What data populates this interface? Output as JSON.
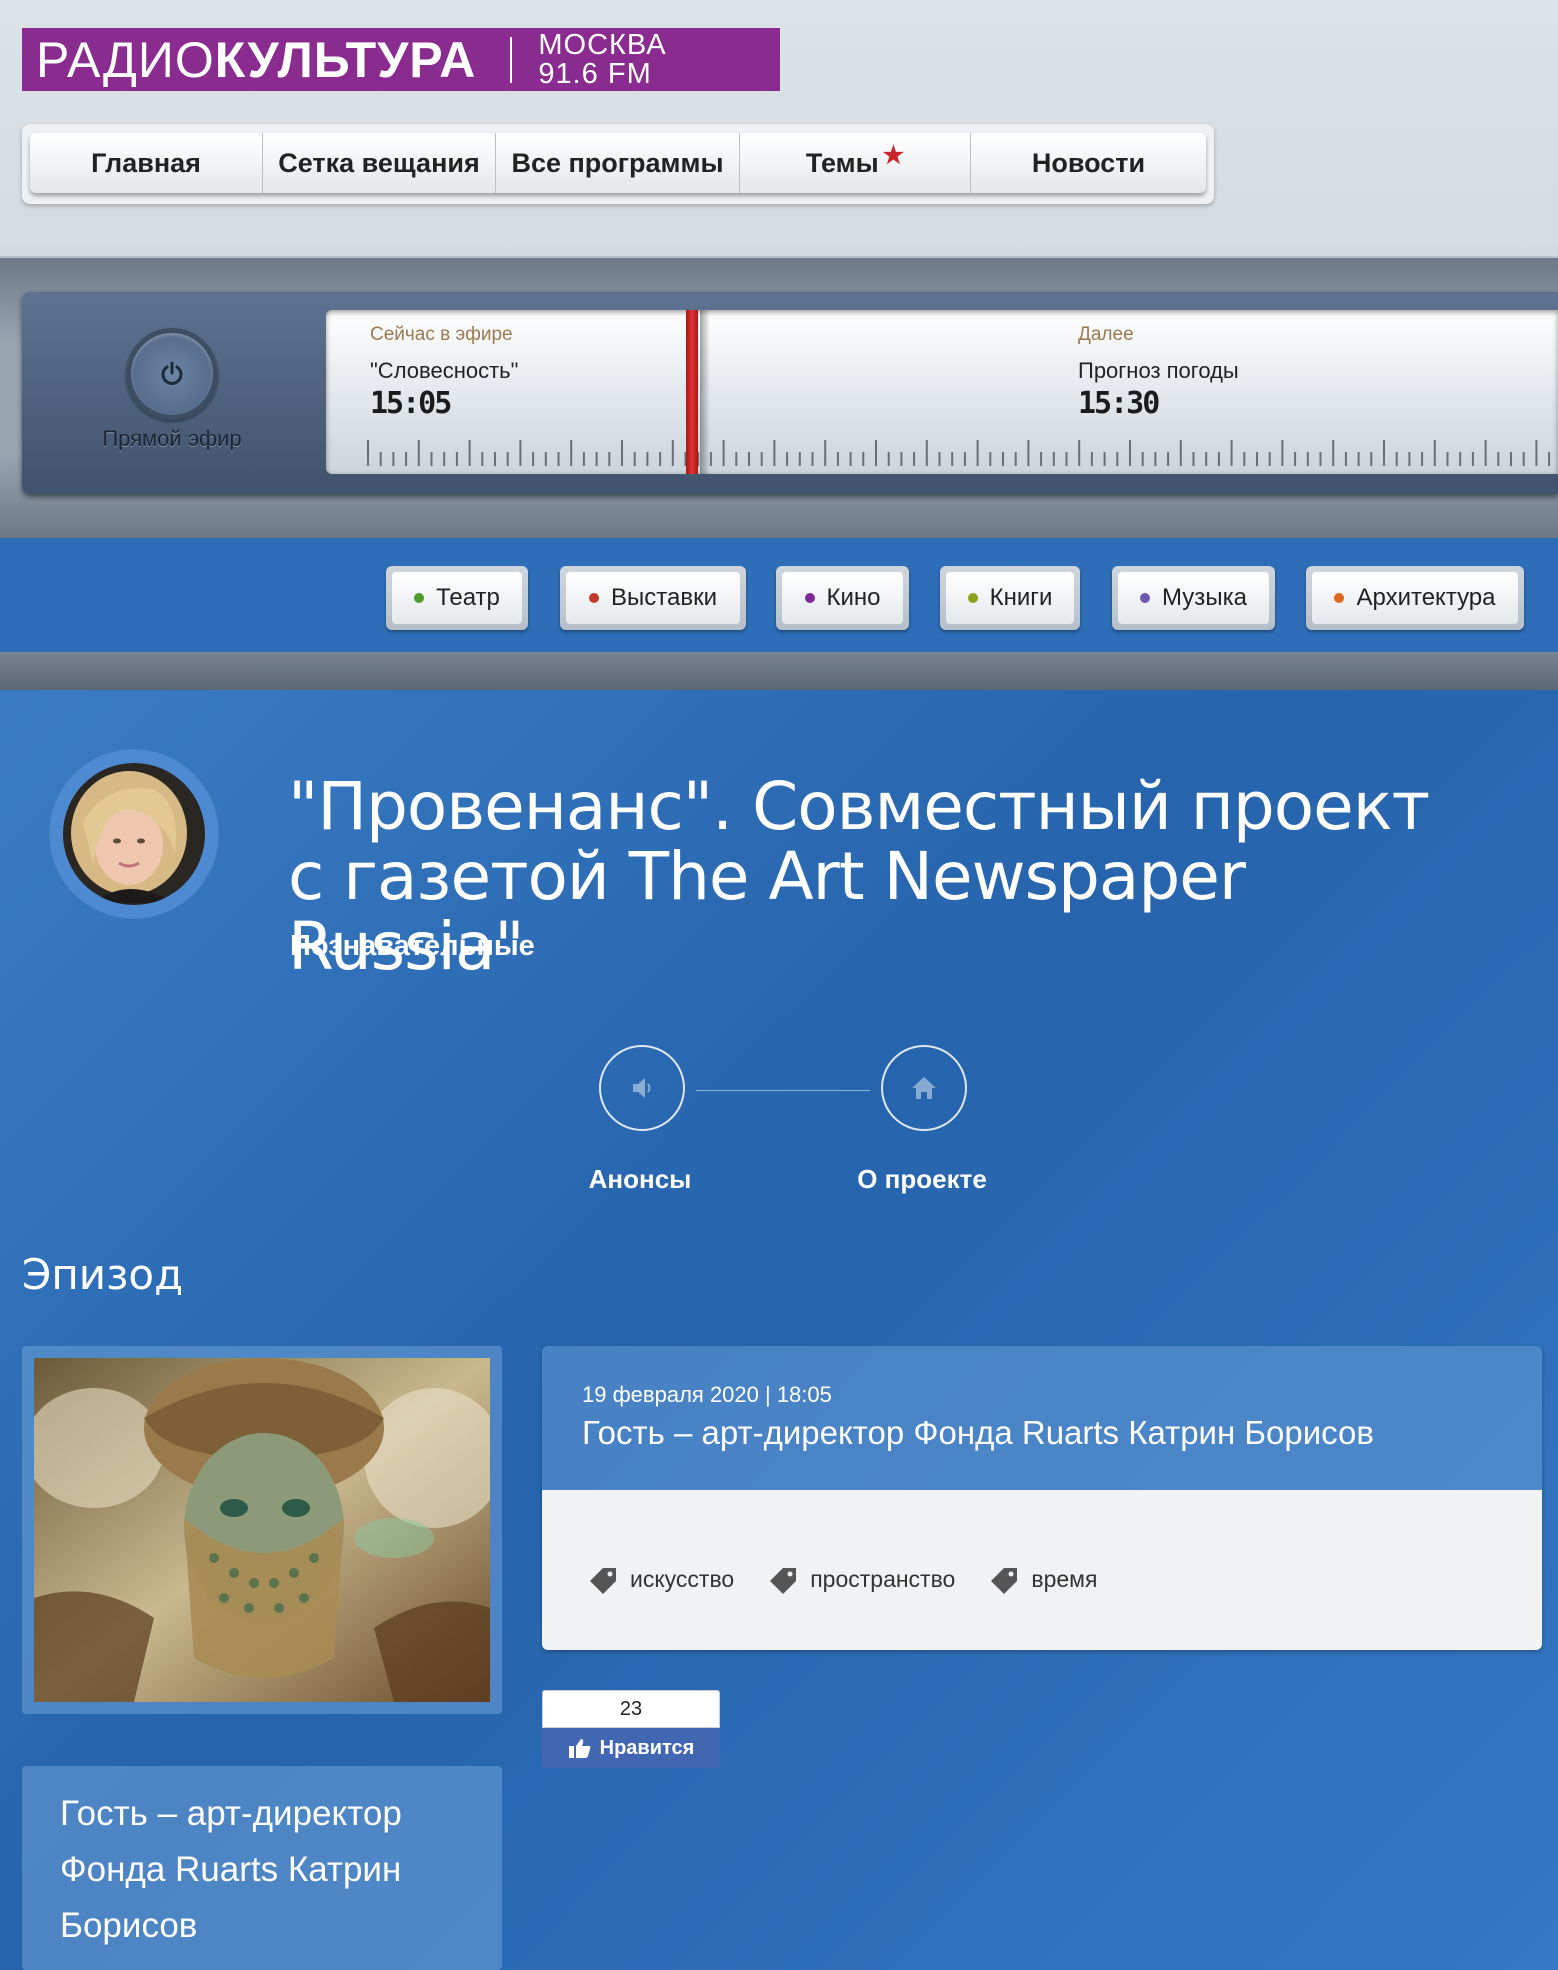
{
  "logo": {
    "main_light": "РАДИО",
    "main_bold": "КУЛЬТУРА",
    "city": "МОСКВА",
    "freq": "91.6 FM",
    "color": "#8a2c8f"
  },
  "nav": {
    "items": [
      "Главная",
      "Сетка вещания",
      "Все программы",
      "Темы",
      "Новости"
    ]
  },
  "live": {
    "button_label": "Прямой эфир",
    "now_label": "Сейчас в эфире",
    "now_title": "\"Словесность\"",
    "now_time": "15:05",
    "next_label": "Далее",
    "next_title": "Прогноз погоды",
    "next_time": "15:30"
  },
  "themes": [
    {
      "label": "Театр",
      "color": "#4e9a2a"
    },
    {
      "label": "Выставки",
      "color": "#c0392b"
    },
    {
      "label": "Кино",
      "color": "#7a2a9a"
    },
    {
      "label": "Книги",
      "color": "#8aa21c"
    },
    {
      "label": "Музыка",
      "color": "#6f58b0"
    },
    {
      "label": "Архитектура",
      "color": "#e0661f"
    }
  ],
  "show": {
    "title": "\"Провенанс\". Совместный проект с газетой The Art Newspaper Russia\"",
    "category": "Познавательные",
    "announces_label": "Анонсы",
    "about_label": "О проекте"
  },
  "episode": {
    "heading": "Эпизод",
    "date": "19 февраля 2020 | 18:05",
    "title": "Гость – арт-директор Фонда Ruarts Катрин Борисов",
    "tags": [
      "искусство",
      "пространство",
      "время"
    ],
    "likes": "23",
    "like_label": "Нравится",
    "side_title": "Гость – арт-директор Фонда Ruarts Катрин Борисов"
  }
}
